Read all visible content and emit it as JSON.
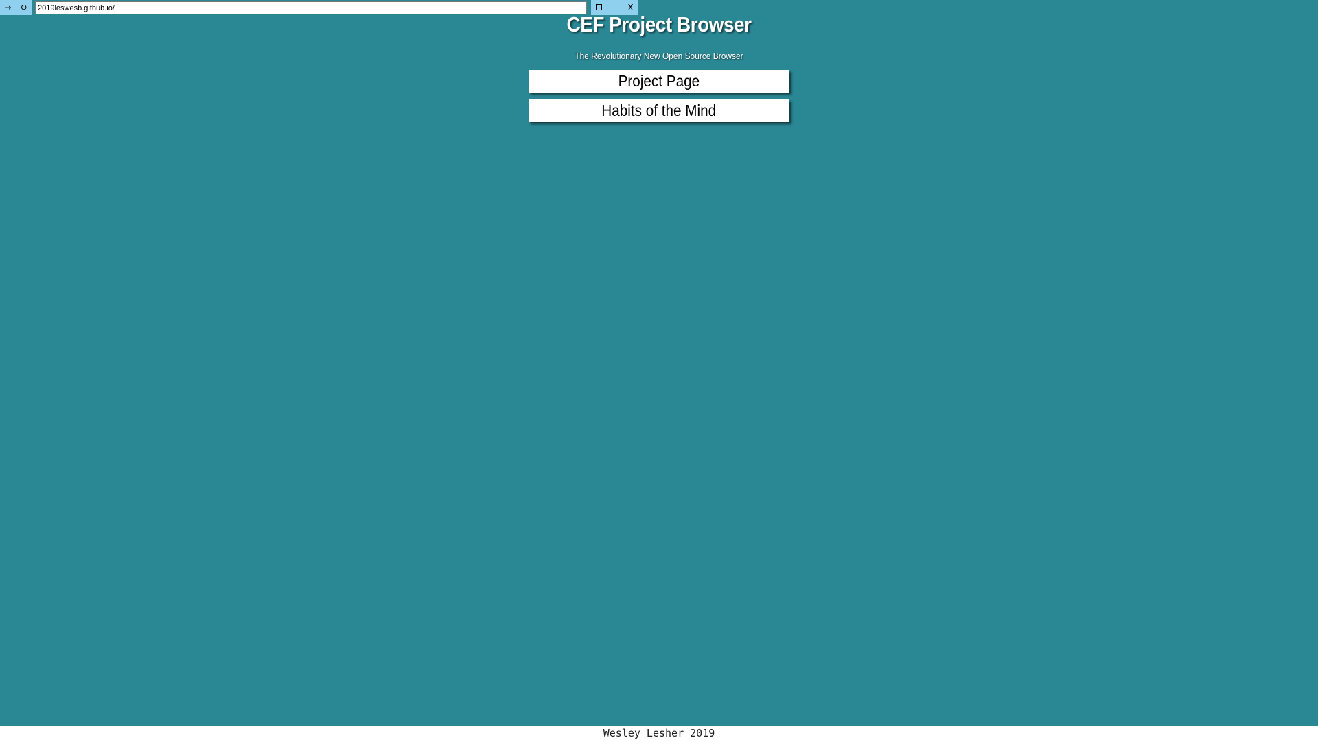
{
  "browser": {
    "go_icon": "→",
    "reload_icon": "↻",
    "address_value": "2019leswesb.github.io/",
    "maximize_icon": "square-outline",
    "minimize_icon": "–",
    "close_label": "X"
  },
  "page": {
    "title": "CEF Project Browser",
    "subtitle": "The Revolutionary New Open Source Browser",
    "buttons": [
      {
        "label": "Project Page"
      },
      {
        "label": "Habits of the Mind"
      }
    ],
    "background_color": "#2a8794"
  },
  "footer": {
    "text": "Wesley Lesher 2019"
  }
}
